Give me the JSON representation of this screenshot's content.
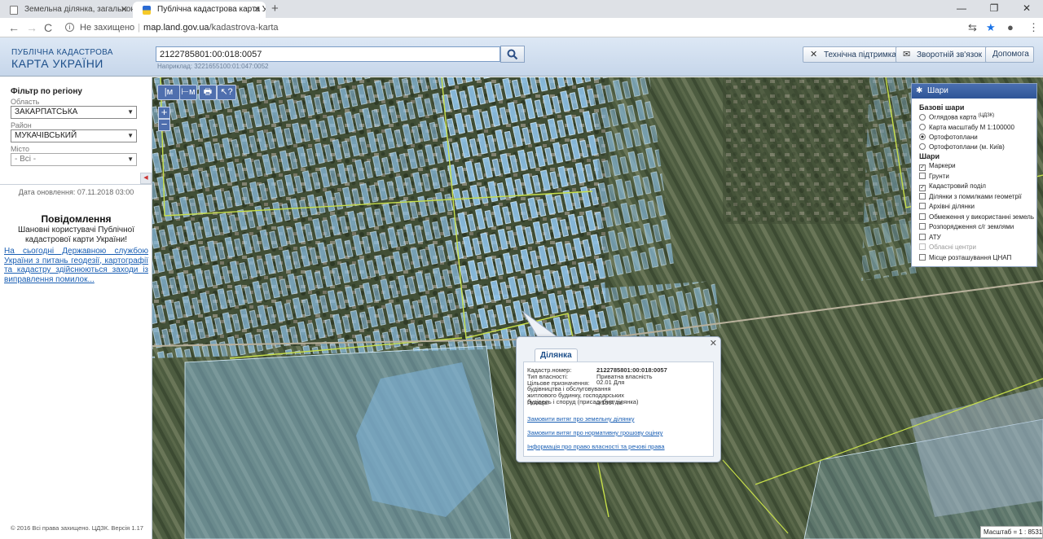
{
  "browser": {
    "tabs": [
      {
        "title": "Земельна ділянка, загальною п"
      },
      {
        "title": "Публічна кадастрова карта Укр"
      }
    ],
    "new_tab": "+",
    "window_controls": [
      "—",
      "❐",
      "✕"
    ],
    "nav": {
      "back": "←",
      "forward": "→",
      "reload": "C"
    },
    "security_label": "Не захищено",
    "url_host": "map.land.gov.ua",
    "url_path": "/kadastrova-karta"
  },
  "header": {
    "logo_line1": "ПУБЛІЧНА КАДАСТРОВА",
    "logo_line2": "КАРТА УКРАЇНИ",
    "search_value": "2122785801:00:018:0057",
    "search_hint": "Наприклад: 3221655100:01:047:0052",
    "buttons": {
      "support": "Технічна підтримка",
      "feedback": "Зворотній зв'язок",
      "help": "Допомога"
    }
  },
  "sidebar": {
    "filter_title": "Фільтр по регіону",
    "oblast_label": "Область",
    "oblast_value": "ЗАКАРПАТСЬКА",
    "rayon_label": "Район",
    "rayon_value": "МУКАЧІВСЬКИЙ",
    "city_label": "Місто",
    "city_value": "- Всі -",
    "update_date": "Дата оновлення: 07.11.2018 03:00",
    "message_title": "Повідомлення",
    "message_text": "Шановні користувачі Публічної кадастрової карти України!",
    "message_link": "На сьогодні Державною службою України з питань геодезії, картографії та кадастру здійснюються заходи із виправлення помилок...",
    "copyright": "© 2016 Всі права захищено. ЦДЗК. Версія 1.17"
  },
  "map": {
    "tools": [
      "|м",
      "⊢м",
      "🖶",
      "↖?"
    ],
    "zoom_in": "+",
    "zoom_out": "−",
    "scale_text": "Масштаб = 1 : 8531",
    "colors": {
      "parcel_fill": "#8fc3ea",
      "boundary": "#c8e04a"
    }
  },
  "layers": {
    "title": "Шари",
    "base_title": "Базові шари",
    "base": [
      {
        "label": "Оглядова карта",
        "sup": "(ЦДЗК)",
        "on": false
      },
      {
        "label": "Карта масштабу М 1:100000",
        "on": false
      },
      {
        "label": "Ортофотоплани",
        "on": true
      },
      {
        "label": "Ортофотоплани (м. Київ)",
        "on": false
      }
    ],
    "overlay_title": "Шари",
    "overlays": [
      {
        "label": "Маркери",
        "checked": true,
        "disabled": false
      },
      {
        "label": "Грунти",
        "checked": false,
        "disabled": false
      },
      {
        "label": "Кадастровий поділ",
        "checked": true,
        "disabled": false
      },
      {
        "label": "Ділянки з помилками геометрії",
        "checked": false,
        "disabled": false
      },
      {
        "label": "Архівні ділянки",
        "checked": false,
        "disabled": false
      },
      {
        "label": "Обмеження у використанні земель",
        "checked": false,
        "disabled": false
      },
      {
        "label": "Розпорядження с/г землями",
        "checked": false,
        "disabled": false
      },
      {
        "label": "АТУ",
        "checked": false,
        "disabled": false
      },
      {
        "label": "Обласні центри",
        "checked": false,
        "disabled": true
      },
      {
        "label": "Місце розташування ЦНАП",
        "checked": false,
        "disabled": false
      }
    ]
  },
  "popup": {
    "close": "✕",
    "tab": "Ділянка",
    "rows": {
      "cad_label": "Кадастр.номер:",
      "cad_value": "2122785801:00:018:0057",
      "own_label": "Тип власності:",
      "own_value": "Приватна власність",
      "purpose_label": "Цільове призначення:",
      "purpose_value": "02.01 Для будівництва і обслуговування житлового будинку, господарських будівель і споруд (присадибна ділянка)",
      "area_label": "Площа:",
      "area_value": "0.1567 га"
    },
    "links": {
      "extract": "Замовити витяг про земельну ділянку",
      "valuation": "Замовити витяг про нормативну грошову оцінку",
      "rights": "Інформація про право власності та речові права"
    }
  }
}
